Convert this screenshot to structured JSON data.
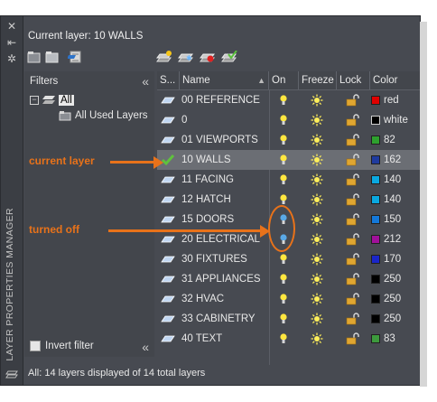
{
  "palette": {
    "title": "LAYER PROPERTIES MANAGER",
    "current_layer": "Current layer: 10 WALLS",
    "status": "All: 14 layers displayed of 14 total layers"
  },
  "filters": {
    "title": "Filters",
    "tree_all": "All",
    "tree_used": "All Used Layers",
    "invert_label": "Invert filter"
  },
  "columns": {
    "status": "S...",
    "name": "Name",
    "on": "On",
    "freeze": "Freeze",
    "lock": "Lock",
    "color": "Color"
  },
  "layers": [
    {
      "name": "00 REFERENCE",
      "color_name": "red",
      "color_hex": "#e00000",
      "on": true,
      "current": false
    },
    {
      "name": "0",
      "color_name": "white",
      "color_hex": "#000000",
      "on": true,
      "current": false
    },
    {
      "name": "01 VIEWPORTS",
      "color_name": "82",
      "color_hex": "#2ea02e",
      "on": true,
      "current": false
    },
    {
      "name": "10 WALLS",
      "color_name": "162",
      "color_hex": "#1f3b9e",
      "on": true,
      "current": true
    },
    {
      "name": "11 FACING",
      "color_name": "140",
      "color_hex": "#0aa8e0",
      "on": true,
      "current": false
    },
    {
      "name": "12 HATCH",
      "color_name": "140",
      "color_hex": "#0aa8e0",
      "on": true,
      "current": false
    },
    {
      "name": "15 DOORS",
      "color_name": "150",
      "color_hex": "#1478d8",
      "on": false,
      "current": false
    },
    {
      "name": "20 ELECTRICAL",
      "color_name": "212",
      "color_hex": "#a0109a",
      "on": false,
      "current": false
    },
    {
      "name": "30 FIXTURES",
      "color_name": "170",
      "color_hex": "#1a26c8",
      "on": true,
      "current": false
    },
    {
      "name": "31 APPLIANCES",
      "color_name": "250",
      "color_hex": "#000000",
      "on": true,
      "current": false
    },
    {
      "name": "32 HVAC",
      "color_name": "250",
      "color_hex": "#000000",
      "on": true,
      "current": false
    },
    {
      "name": "33 CABINETRY",
      "color_name": "250",
      "color_hex": "#000000",
      "on": true,
      "current": false
    },
    {
      "name": "40 TEXT",
      "color_name": "83",
      "color_hex": "#3d9a3d",
      "on": true,
      "current": false
    }
  ],
  "annotations": {
    "current_layer": "current layer",
    "turned_off": "turned off",
    "accent": "#e8721a"
  },
  "icons": {
    "close": "close-icon",
    "autohide": "auto-hide-icon",
    "settings": "settings-icon",
    "bulb_on": "lightbulb-on-icon",
    "bulb_off": "lightbulb-off-icon",
    "sun": "thaw-sun-icon",
    "lock": "unlocked-padlock-icon",
    "layer": "layer-parallelogram-icon",
    "check": "checkmark-icon"
  }
}
